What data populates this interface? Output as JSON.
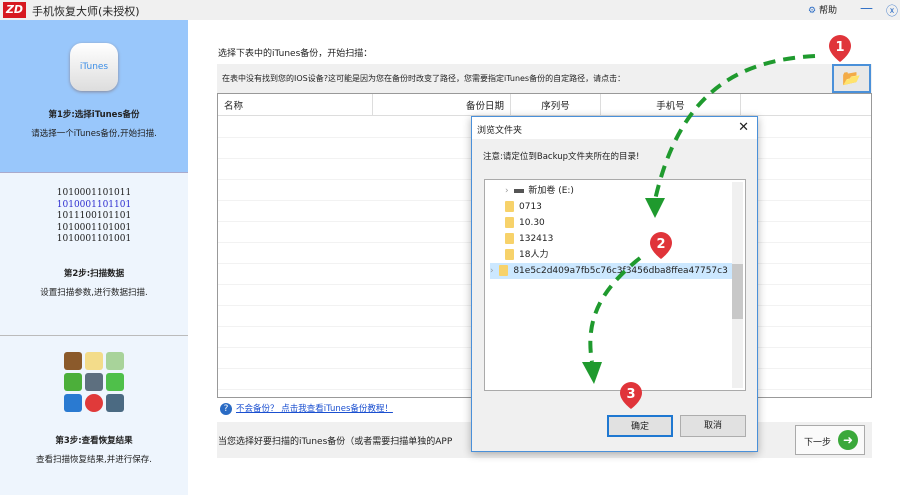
{
  "app": {
    "logo": "ZD",
    "title": "手机恢复大师(未授权)",
    "help_label": "帮助",
    "minimize_icon": "minus-icon",
    "close_icon": "close-circle-icon"
  },
  "sidebar": {
    "steps": [
      {
        "title": "第1步:选择iTunes备份",
        "desc": "请选择一个iTunes备份,开始扫描.",
        "icon_text": "iTunes",
        "active": true
      },
      {
        "title": "第2步:扫描数据",
        "desc": "设置扫描参数,进行数据扫描.",
        "binary": [
          "1010001101011",
          "1010001101101",
          "1011100101101",
          "1010001101001",
          "1010001101001"
        ]
      },
      {
        "title": "第3步:查看恢复结果",
        "desc": "查看扫描恢复结果,并进行保存."
      }
    ]
  },
  "main": {
    "instruction": "选择下表中的iTunes备份，开始扫描：",
    "hint": "在表中没有找到您的IOS设备?这可能是因为您在备份时改变了路径，您需要指定iTunes备份的自定路径，请点击：",
    "columns": [
      "名称",
      "备份日期",
      "序列号",
      "手机号"
    ],
    "help_link": "不会备份？ 点击我查看iTunes备份教程！",
    "bottom_text": "当您选择好要扫描的iTunes备份（或者需要扫描单独的APP",
    "next_label": "下一步"
  },
  "dialog": {
    "title": "浏览文件夹",
    "note": "注意:请定位到Backup文件夹所在的目录!",
    "tree": [
      {
        "label": "新加卷 (E:)",
        "type": "drive"
      },
      {
        "label": "0713",
        "type": "folder"
      },
      {
        "label": "10.30",
        "type": "folder"
      },
      {
        "label": "132413",
        "type": "folder"
      },
      {
        "label": "18人力",
        "type": "folder"
      },
      {
        "label": "81e5c2d409a7fb5c76c3f3456dba8ffea47757c3",
        "type": "folder",
        "selected": true
      }
    ],
    "ok_label": "确定",
    "cancel_label": "取消"
  },
  "annotations": {
    "markers": [
      "1",
      "2",
      "3"
    ],
    "arrow_color": "#1f9a2e",
    "marker_color": "#e0343a"
  },
  "colors": {
    "step_active": "#99c7fb",
    "step_inactive": "#eef5fd",
    "accent": "#4a90d9"
  }
}
